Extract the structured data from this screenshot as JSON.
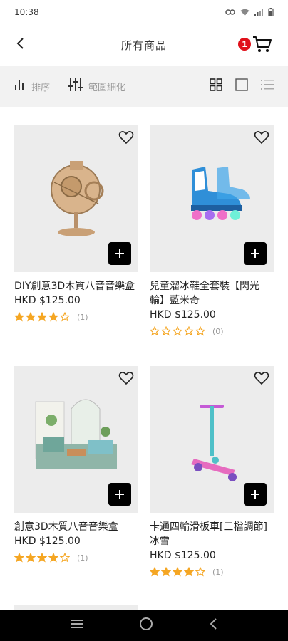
{
  "status": {
    "time": "10:38"
  },
  "header": {
    "title": "所有商品",
    "cart_count": "1"
  },
  "toolbar": {
    "sort_label": "排序",
    "filter_label": "範圍細化"
  },
  "products": [
    {
      "name": "DIY創意3D木質八音音樂盒",
      "price": "HKD $125.00",
      "rating": 4,
      "reviews": "(1)"
    },
    {
      "name": "兒童溜冰鞋全套裝【閃光輪】藍米奇",
      "price": "HKD $125.00",
      "rating": 0,
      "reviews": "(0)"
    },
    {
      "name": "創意3D木質八音音樂盒",
      "price": "HKD $125.00",
      "rating": 4,
      "reviews": "(1)"
    },
    {
      "name": "卡通四輪滑板車[三檔調節]冰雪",
      "price": "HKD $125.00",
      "rating": 4,
      "reviews": "(1)"
    }
  ],
  "colors": {
    "star": "#f5a623",
    "badge": "#e0101a",
    "card_bg": "#ececec"
  }
}
